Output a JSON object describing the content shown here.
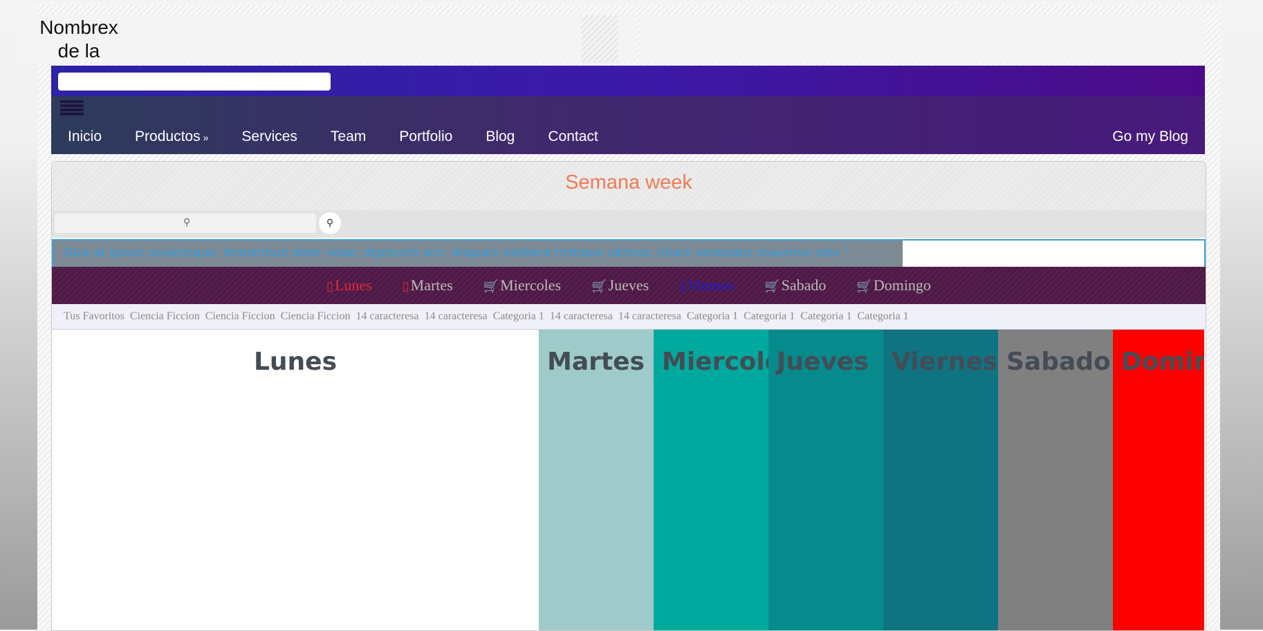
{
  "header": {
    "site_name": "Nombrex de la",
    "top_search": {
      "placeholder": ""
    }
  },
  "nav": {
    "items": [
      {
        "label": "Inicio"
      },
      {
        "label": "Productos",
        "has_dropdown": true
      },
      {
        "label": "Services"
      },
      {
        "label": "Team"
      },
      {
        "label": "Portfolio"
      },
      {
        "label": "Blog"
      },
      {
        "label": "Contact"
      }
    ],
    "right_label": "Go my Blog",
    "dropdown_icon": "double-chevron-down-icon"
  },
  "panel": {
    "title": "Semana week",
    "search": {
      "placeholder": "",
      "icon": "search-icon"
    },
    "marquee": "Duis at ipsum scelerisque, fermentum dolor vitae, dignissim orci. Aliquam eleifend tristique ultrices. Etiam venenatis maximus odio \""
  },
  "days": [
    {
      "label": "Lunes",
      "icon": "mobile-icon",
      "color": "#e0283c"
    },
    {
      "label": "Martes",
      "icon": "mobile-icon",
      "color": "#bbbbbb",
      "icon_color": "#e0283c"
    },
    {
      "label": "Miercoles",
      "icon": "cart-icon",
      "color": "#bbbbbb",
      "icon_color": "#1a8a1a"
    },
    {
      "label": "Jueves",
      "icon": "cart-icon",
      "color": "#bbbbbb",
      "icon_color": "#f2e600"
    },
    {
      "label": "Viernes",
      "icon": "mobile-icon",
      "color": "#1a1ae0",
      "icon_color": "#1a1ae0"
    },
    {
      "label": "Sabado",
      "icon": "cart-icon",
      "color": "#bbbbbb",
      "icon_color": "#bbbbbb"
    },
    {
      "label": "Domingo",
      "icon": "cart-icon",
      "color": "#bbbbbb",
      "icon_color": "#bbbbbb"
    }
  ],
  "favorites": [
    "Tus Favoritos",
    "Ciencia Ficcion",
    "Ciencia Ficcion",
    "Ciencia Ficcion",
    "14 caracteresa",
    "14 caracteresa",
    "Categoria 1",
    "14 caracteresa",
    "14 caracteresa",
    "Categoria 1",
    "Categoria 1",
    "Categoria 1",
    "Categoria 1"
  ],
  "columns": [
    {
      "label": "Lunes",
      "bg": "#ffffff"
    },
    {
      "label": "Martes",
      "bg": "#9ecbc9"
    },
    {
      "label": "Miercoles",
      "bg": "#00a99d"
    },
    {
      "label": "Jueves",
      "bg": "#078a8c"
    },
    {
      "label": "Viernes",
      "bg": "#107382"
    },
    {
      "label": "Sabado",
      "bg": "#808080"
    },
    {
      "label": "Domingo",
      "bg": "#ff0000"
    }
  ]
}
